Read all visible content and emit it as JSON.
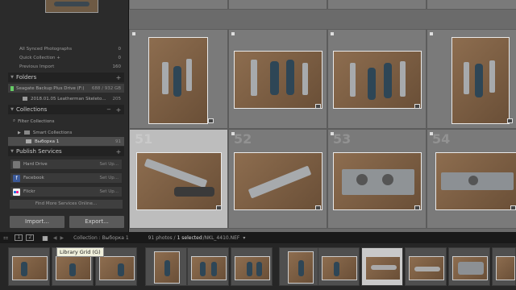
{
  "catalog": [
    {
      "label": "All Synced Photographs",
      "count": "0"
    },
    {
      "label": "Quick Collection +",
      "count": "0"
    },
    {
      "label": "Previous Import",
      "count": "160"
    }
  ],
  "folders": {
    "title": "Folders",
    "drive": {
      "name": "Seagate Backup Plus Drive (F:)",
      "space": "688 / 932 GB"
    },
    "folder": {
      "name": "2018.01.05 Leatherman Skeleto...",
      "count": "205"
    }
  },
  "collections": {
    "title": "Collections",
    "filter": "Filter Collections",
    "smart": "Smart Collections",
    "selected": {
      "name": "Выборка 1",
      "count": "91"
    }
  },
  "publish": {
    "title": "Publish Services",
    "services": [
      {
        "name": "Hard Drive",
        "action": "Set Up..."
      },
      {
        "name": "Facebook",
        "action": "Set Up..."
      },
      {
        "name": "Flickr",
        "action": "Set Up..."
      }
    ],
    "find_more": "Find More Services Online..."
  },
  "buttons": {
    "import": "Import...",
    "export": "Export..."
  },
  "grid_numbers": [
    "51",
    "52",
    "53",
    "54"
  ],
  "toolbar": {
    "page1": "1",
    "page2": "2",
    "collection": "Collection : Выборка 1",
    "photos": "91 photos /",
    "selected": "1 selected",
    "filename": "/NKL_4410.NEF",
    "dropdown": "▾"
  },
  "tooltip": "Library Grid (G)"
}
